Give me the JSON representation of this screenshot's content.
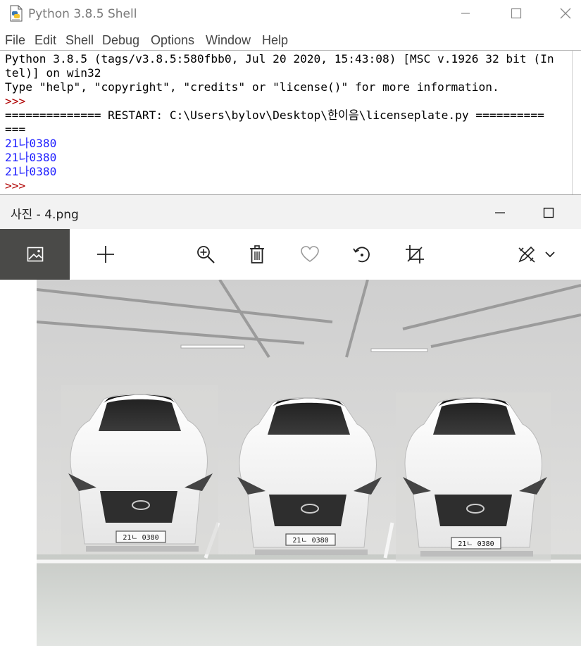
{
  "idle": {
    "title": "Python 3.8.5 Shell",
    "menu": [
      "File",
      "Edit",
      "Shell",
      "Debug",
      "Options",
      "Window",
      "Help"
    ],
    "shell_lines": [
      {
        "text": "Python 3.8.5 (tags/v3.8.5:580fbb0, Jul 20 2020, 15:43:08) [MSC v.1926 32 bit (In",
        "kind": "text"
      },
      {
        "text": "tel)] on win32",
        "kind": "text"
      },
      {
        "text": "Type \"help\", \"copyright\", \"credits\" or \"license()\" for more information.",
        "kind": "text"
      },
      {
        "text": ">>> ",
        "kind": "prompt"
      },
      {
        "text": "============== RESTART: C:\\Users\\bylov\\Desktop\\한이음\\licenseplate.py ==========",
        "kind": "text"
      },
      {
        "text": "===",
        "kind": "text"
      },
      {
        "text": "21나0380",
        "kind": "output"
      },
      {
        "text": "21나0380",
        "kind": "output"
      },
      {
        "text": "21나0380",
        "kind": "output"
      },
      {
        "text": ">>> ",
        "kind": "prompt"
      }
    ]
  },
  "photos": {
    "title": "사진 - 4.png",
    "toolbar": {
      "active_icon": "image-icon",
      "items": [
        "add-icon",
        "zoom-in-icon",
        "delete-icon",
        "favorite-icon",
        "rotate-icon",
        "crop-icon",
        "edit-icon",
        "chevron-down-icon"
      ]
    },
    "plate_text": "21ㄴ 0380"
  },
  "colors": {
    "shell_output": "#2020ff",
    "shell_prompt": "#b00000",
    "photos_toolbar_active": "#4a4a48",
    "car_body": "#f3f3f3"
  }
}
